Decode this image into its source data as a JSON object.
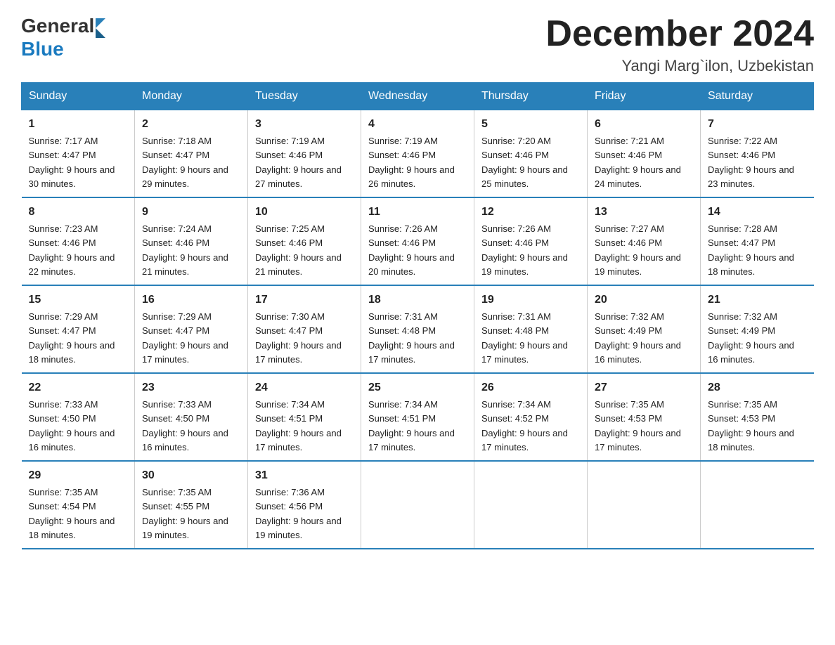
{
  "header": {
    "title": "December 2024",
    "location": "Yangi Marg`ilon, Uzbekistan",
    "logo_general": "General",
    "logo_blue": "Blue"
  },
  "days_of_week": [
    "Sunday",
    "Monday",
    "Tuesday",
    "Wednesday",
    "Thursday",
    "Friday",
    "Saturday"
  ],
  "weeks": [
    [
      {
        "day": "1",
        "sunrise": "7:17 AM",
        "sunset": "4:47 PM",
        "daylight": "9 hours and 30 minutes."
      },
      {
        "day": "2",
        "sunrise": "7:18 AM",
        "sunset": "4:47 PM",
        "daylight": "9 hours and 29 minutes."
      },
      {
        "day": "3",
        "sunrise": "7:19 AM",
        "sunset": "4:46 PM",
        "daylight": "9 hours and 27 minutes."
      },
      {
        "day": "4",
        "sunrise": "7:19 AM",
        "sunset": "4:46 PM",
        "daylight": "9 hours and 26 minutes."
      },
      {
        "day": "5",
        "sunrise": "7:20 AM",
        "sunset": "4:46 PM",
        "daylight": "9 hours and 25 minutes."
      },
      {
        "day": "6",
        "sunrise": "7:21 AM",
        "sunset": "4:46 PM",
        "daylight": "9 hours and 24 minutes."
      },
      {
        "day": "7",
        "sunrise": "7:22 AM",
        "sunset": "4:46 PM",
        "daylight": "9 hours and 23 minutes."
      }
    ],
    [
      {
        "day": "8",
        "sunrise": "7:23 AM",
        "sunset": "4:46 PM",
        "daylight": "9 hours and 22 minutes."
      },
      {
        "day": "9",
        "sunrise": "7:24 AM",
        "sunset": "4:46 PM",
        "daylight": "9 hours and 21 minutes."
      },
      {
        "day": "10",
        "sunrise": "7:25 AM",
        "sunset": "4:46 PM",
        "daylight": "9 hours and 21 minutes."
      },
      {
        "day": "11",
        "sunrise": "7:26 AM",
        "sunset": "4:46 PM",
        "daylight": "9 hours and 20 minutes."
      },
      {
        "day": "12",
        "sunrise": "7:26 AM",
        "sunset": "4:46 PM",
        "daylight": "9 hours and 19 minutes."
      },
      {
        "day": "13",
        "sunrise": "7:27 AM",
        "sunset": "4:46 PM",
        "daylight": "9 hours and 19 minutes."
      },
      {
        "day": "14",
        "sunrise": "7:28 AM",
        "sunset": "4:47 PM",
        "daylight": "9 hours and 18 minutes."
      }
    ],
    [
      {
        "day": "15",
        "sunrise": "7:29 AM",
        "sunset": "4:47 PM",
        "daylight": "9 hours and 18 minutes."
      },
      {
        "day": "16",
        "sunrise": "7:29 AM",
        "sunset": "4:47 PM",
        "daylight": "9 hours and 17 minutes."
      },
      {
        "day": "17",
        "sunrise": "7:30 AM",
        "sunset": "4:47 PM",
        "daylight": "9 hours and 17 minutes."
      },
      {
        "day": "18",
        "sunrise": "7:31 AM",
        "sunset": "4:48 PM",
        "daylight": "9 hours and 17 minutes."
      },
      {
        "day": "19",
        "sunrise": "7:31 AM",
        "sunset": "4:48 PM",
        "daylight": "9 hours and 17 minutes."
      },
      {
        "day": "20",
        "sunrise": "7:32 AM",
        "sunset": "4:49 PM",
        "daylight": "9 hours and 16 minutes."
      },
      {
        "day": "21",
        "sunrise": "7:32 AM",
        "sunset": "4:49 PM",
        "daylight": "9 hours and 16 minutes."
      }
    ],
    [
      {
        "day": "22",
        "sunrise": "7:33 AM",
        "sunset": "4:50 PM",
        "daylight": "9 hours and 16 minutes."
      },
      {
        "day": "23",
        "sunrise": "7:33 AM",
        "sunset": "4:50 PM",
        "daylight": "9 hours and 16 minutes."
      },
      {
        "day": "24",
        "sunrise": "7:34 AM",
        "sunset": "4:51 PM",
        "daylight": "9 hours and 17 minutes."
      },
      {
        "day": "25",
        "sunrise": "7:34 AM",
        "sunset": "4:51 PM",
        "daylight": "9 hours and 17 minutes."
      },
      {
        "day": "26",
        "sunrise": "7:34 AM",
        "sunset": "4:52 PM",
        "daylight": "9 hours and 17 minutes."
      },
      {
        "day": "27",
        "sunrise": "7:35 AM",
        "sunset": "4:53 PM",
        "daylight": "9 hours and 17 minutes."
      },
      {
        "day": "28",
        "sunrise": "7:35 AM",
        "sunset": "4:53 PM",
        "daylight": "9 hours and 18 minutes."
      }
    ],
    [
      {
        "day": "29",
        "sunrise": "7:35 AM",
        "sunset": "4:54 PM",
        "daylight": "9 hours and 18 minutes."
      },
      {
        "day": "30",
        "sunrise": "7:35 AM",
        "sunset": "4:55 PM",
        "daylight": "9 hours and 19 minutes."
      },
      {
        "day": "31",
        "sunrise": "7:36 AM",
        "sunset": "4:56 PM",
        "daylight": "9 hours and 19 minutes."
      },
      null,
      null,
      null,
      null
    ]
  ]
}
